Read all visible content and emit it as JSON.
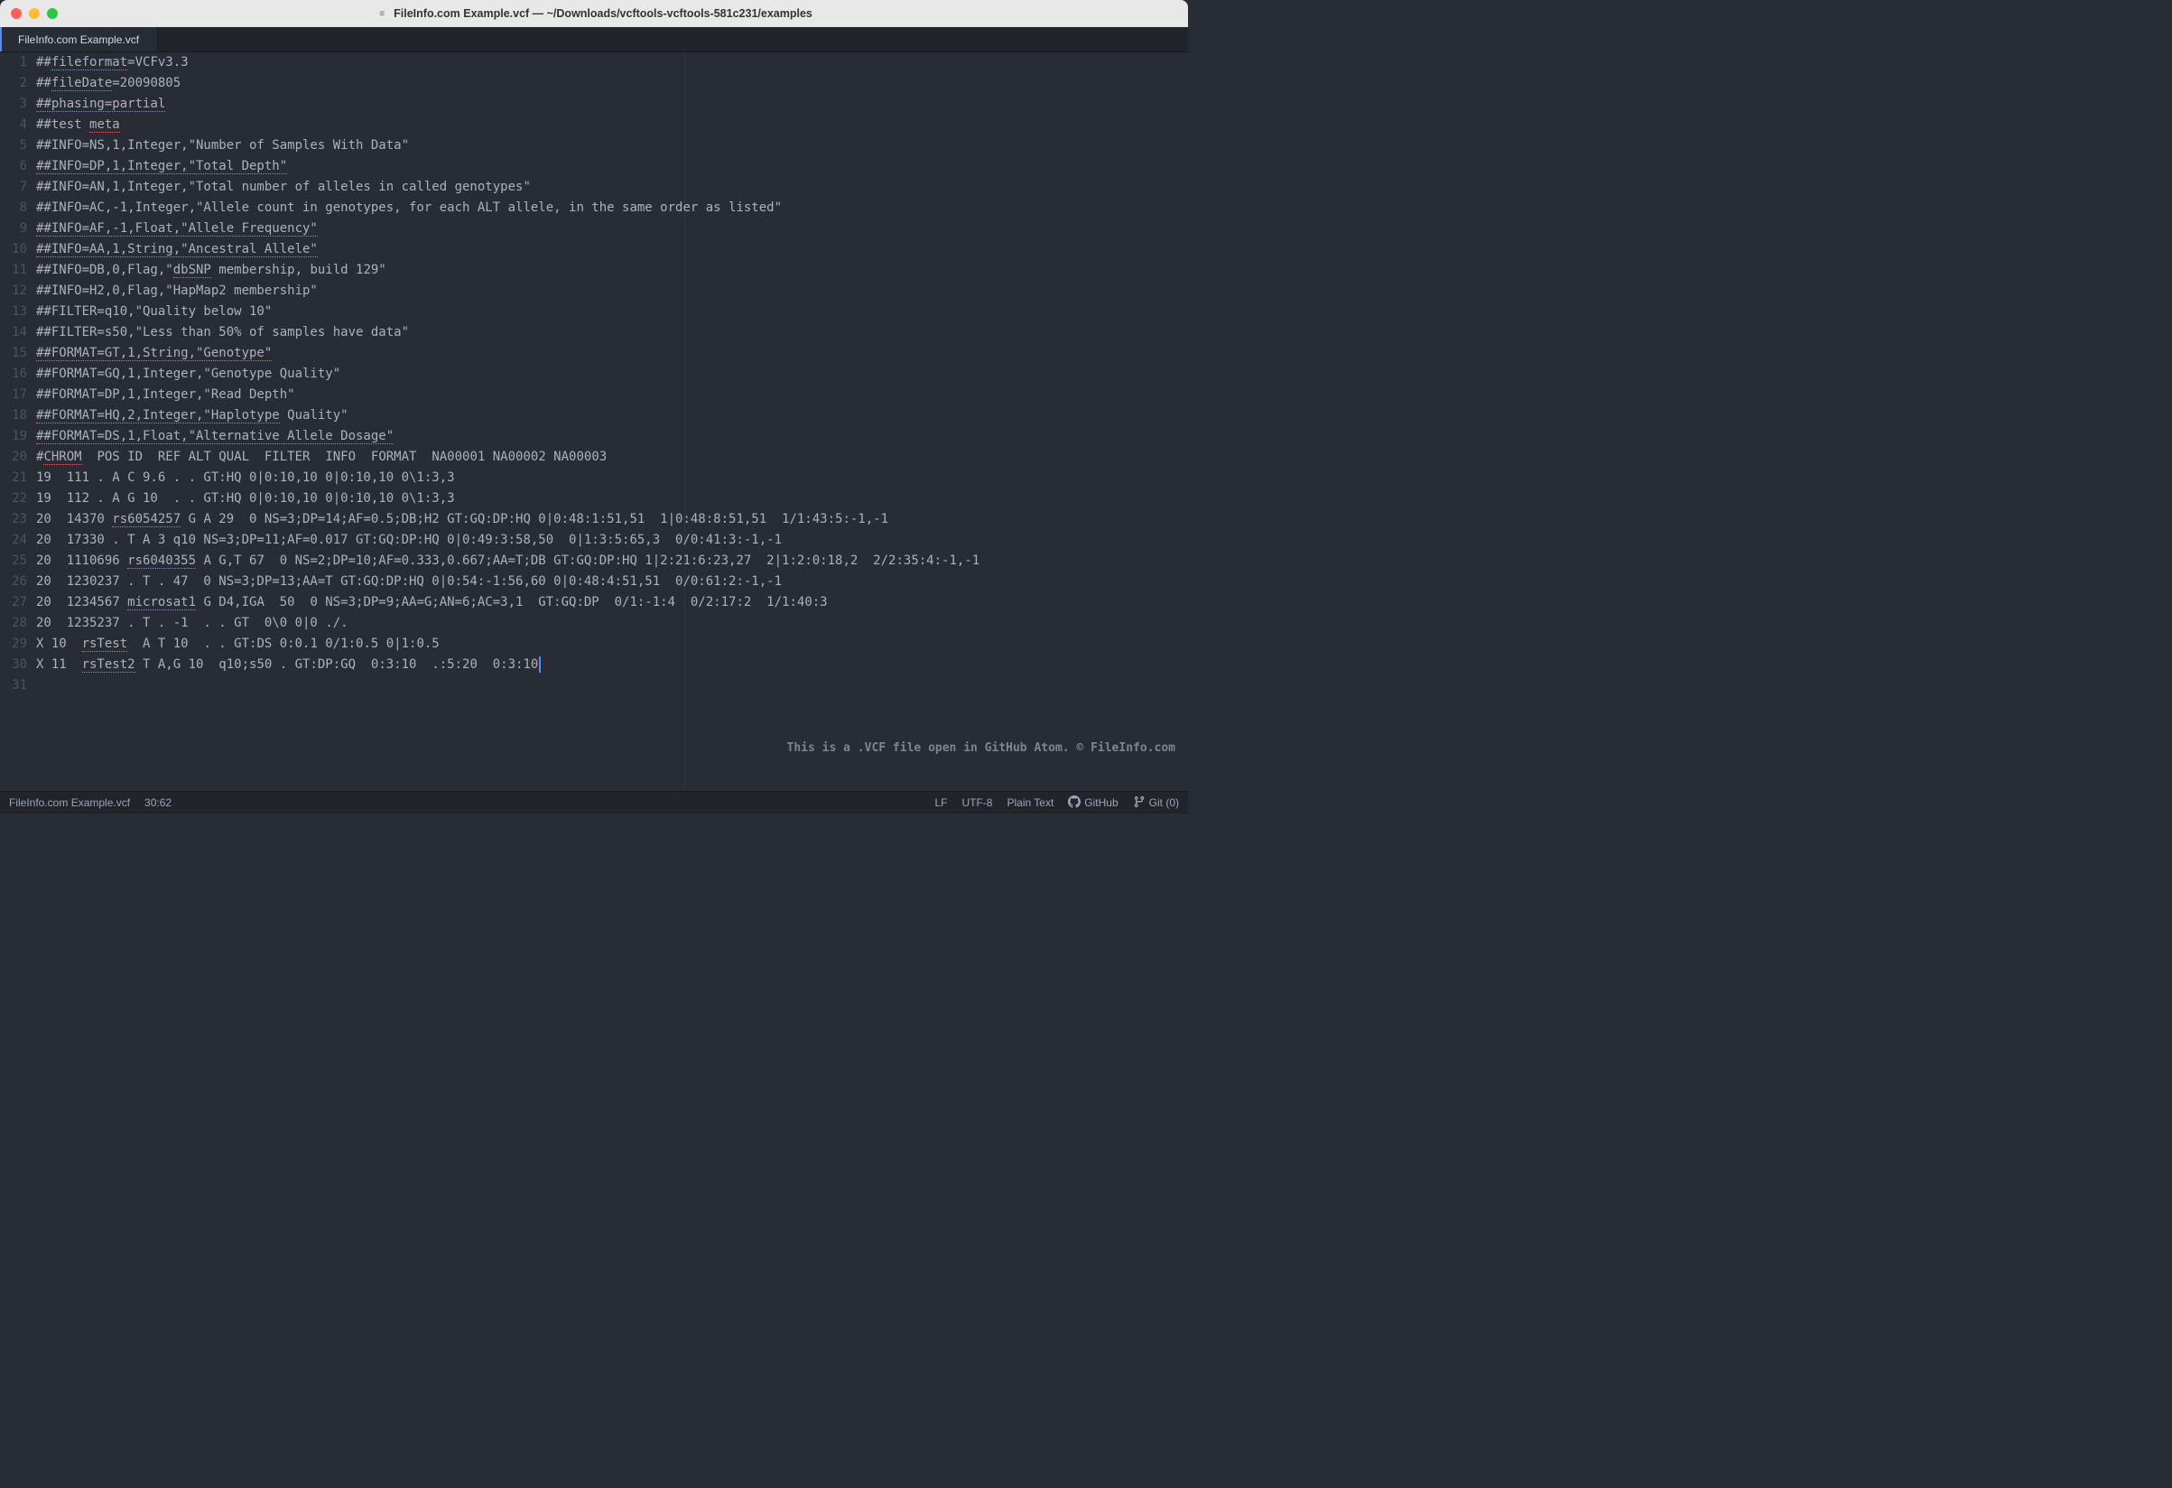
{
  "window": {
    "title_icon": "≡",
    "title": "FileInfo.com Example.vcf — ~/Downloads/vcftools-vcftools-581c231/examples"
  },
  "tabs": [
    {
      "label": "FileInfo.com Example.vcf",
      "active": true
    }
  ],
  "gutter_lines": [
    "1",
    "2",
    "3",
    "4",
    "5",
    "6",
    "7",
    "8",
    "9",
    "10",
    "11",
    "12",
    "13",
    "14",
    "15",
    "16",
    "17",
    "18",
    "19",
    "20",
    "21",
    "22",
    "23",
    "24",
    "25",
    "26",
    "27",
    "28",
    "29",
    "30",
    "31"
  ],
  "code_lines": [
    {
      "segments": [
        {
          "t": "##"
        },
        {
          "t": "fileformat",
          "s": 1
        },
        {
          "t": "=VCFv3.3"
        }
      ]
    },
    {
      "segments": [
        {
          "t": "##"
        },
        {
          "t": "fileDate",
          "s": 1
        },
        {
          "t": "=20090805"
        }
      ]
    },
    {
      "segments": [
        {
          "t": "##phasing=partial",
          "s": 1
        }
      ]
    },
    {
      "segments": [
        {
          "t": "##test "
        },
        {
          "t": "meta",
          "s": 1
        }
      ]
    },
    {
      "segments": [
        {
          "t": "##INFO=NS,1,Integer,\"Number of Samples With Data\""
        }
      ]
    },
    {
      "segments": [
        {
          "t": "##INFO=DP,1,Integer,\"Total Depth\"",
          "s": 1
        }
      ]
    },
    {
      "segments": [
        {
          "t": "##INFO=AN,1,Integer,\"Total number of alleles in called genotypes\""
        }
      ]
    },
    {
      "segments": [
        {
          "t": "##INFO=AC,-1,Integer,\"Allele count in genotypes, for each ALT allele, in the same order as listed\""
        }
      ]
    },
    {
      "segments": [
        {
          "t": "##INFO=AF,-1,Float,\"Allele Frequency\"",
          "s": 1
        }
      ]
    },
    {
      "segments": [
        {
          "t": "##INFO=AA,1,String,\"Ancestral Allele\"",
          "s": 1
        }
      ]
    },
    {
      "segments": [
        {
          "t": "##INFO=DB,0,Flag,\""
        },
        {
          "t": "dbSNP",
          "s": 1
        },
        {
          "t": " membership, build 129\""
        }
      ]
    },
    {
      "segments": [
        {
          "t": "##INFO=H2,0,Flag,\"HapMap2 membership\""
        }
      ]
    },
    {
      "segments": [
        {
          "t": "##FILTER=q10,\"Quality below 10\""
        }
      ]
    },
    {
      "segments": [
        {
          "t": "##FILTER=s50,\"Less than 50% of samples have data\""
        }
      ]
    },
    {
      "segments": [
        {
          "t": "##FORMAT=GT,1,String,\"Genotype\"",
          "s": 1
        }
      ]
    },
    {
      "segments": [
        {
          "t": "##FORMAT=GQ,1,Integer,\"Genotype Quality\""
        }
      ]
    },
    {
      "segments": [
        {
          "t": "##FORMAT=DP,1,Integer,\"Read Depth\""
        }
      ]
    },
    {
      "segments": [
        {
          "t": "##FORMAT=HQ,2,Integer,\"Haplotype",
          "s": 1
        },
        {
          "t": " Quality\""
        }
      ]
    },
    {
      "segments": [
        {
          "t": "##FORMAT=DS,1,Float,\"Alternative Allele Dosage\"",
          "s": 1
        }
      ]
    },
    {
      "segments": [
        {
          "t": "#"
        },
        {
          "t": "CHROM",
          "s": 1
        },
        {
          "t": "  POS ID  REF ALT QUAL  FILTER  INFO  FORMAT  NA00001 NA00002 NA00003"
        }
      ]
    },
    {
      "segments": [
        {
          "t": "19  111 . A C 9.6 . . GT:HQ 0|0:10,10 0|0:10,10 0\\1:3,3"
        }
      ]
    },
    {
      "segments": [
        {
          "t": "19  112 . A G 10  . . GT:HQ 0|0:10,10 0|0:10,10 0\\1:3,3"
        }
      ]
    },
    {
      "segments": [
        {
          "t": "20  14370 "
        },
        {
          "t": "rs6054257",
          "s": 1
        },
        {
          "t": " G A 29  0 NS=3;DP=14;AF=0.5;DB;H2 GT:GQ:DP:HQ 0|0:48:1:51,51  1|0:48:8:51,51  1/1:43:5:-1,-1"
        }
      ]
    },
    {
      "segments": [
        {
          "t": "20  17330 . T A 3 q10 NS=3;DP=11;AF=0.017 GT:GQ:DP:HQ 0|0:49:3:58,50  0|1:3:5:65,3  0/0:41:3:-1,-1"
        }
      ]
    },
    {
      "segments": [
        {
          "t": "20  1110696 "
        },
        {
          "t": "rs6040355",
          "s": 1
        },
        {
          "t": " A G,T 67  0 NS=2;DP=10;AF=0.333,0.667;AA=T;DB GT:GQ:DP:HQ 1|2:21:6:23,27  2|1:2:0:18,2  2/2:35:4:-1,-1"
        }
      ]
    },
    {
      "segments": [
        {
          "t": "20  1230237 . T . 47  0 NS=3;DP=13;AA=T GT:GQ:DP:HQ 0|0:54:-1:56,60 0|0:48:4:51,51  0/0:61:2:-1,-1"
        }
      ]
    },
    {
      "segments": [
        {
          "t": "20  1234567 "
        },
        {
          "t": "microsat1",
          "s": 1
        },
        {
          "t": " G D4,IGA  50  0 NS=3;DP=9;AA=G;AN=6;AC=3,1  GT:GQ:DP  0/1:-1:4  0/2:17:2  1/1:40:3"
        }
      ]
    },
    {
      "segments": [
        {
          "t": "20  1235237 . T . -1  . . GT  0\\0 0|0 ./."
        }
      ]
    },
    {
      "segments": [
        {
          "t": "X 10  "
        },
        {
          "t": "rsTest",
          "s": 1
        },
        {
          "t": "  A T 10  . . GT:DS 0:0.1 0/1:0.5 0|1:0.5"
        }
      ]
    },
    {
      "segments": [
        {
          "t": "X 11  "
        },
        {
          "t": "rsTest2",
          "s": 1
        },
        {
          "t": " T A,G 10  q10;s50 . GT:DP:GQ  0:3:10  .:5:20  0:3:10"
        }
      ],
      "cursor": true
    },
    {
      "segments": [
        {
          "t": ""
        }
      ]
    }
  ],
  "watermark": "This is a .VCF file open in GitHub Atom. © FileInfo.com",
  "status": {
    "filename": "FileInfo.com Example.vcf",
    "cursor": "30:62",
    "line_ending": "LF",
    "encoding": "UTF-8",
    "grammar": "Plain Text",
    "github_label": "GitHub",
    "git_label": "Git (0)"
  }
}
